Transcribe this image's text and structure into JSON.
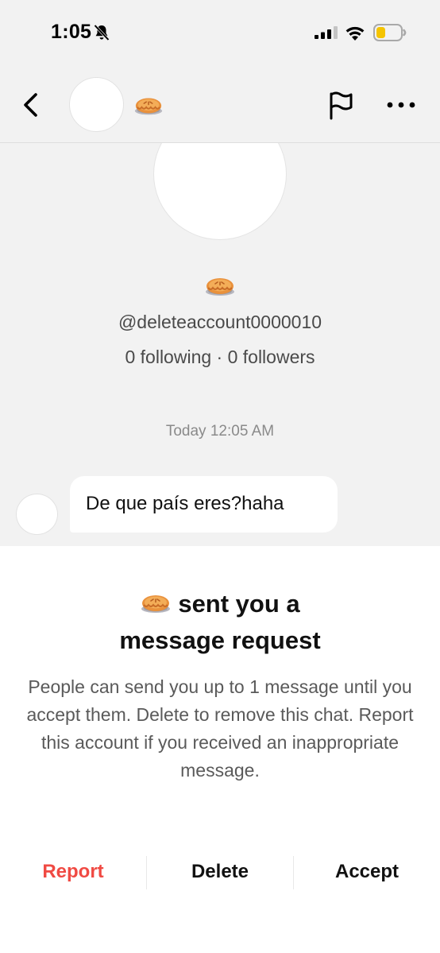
{
  "status_bar": {
    "time": "1:05",
    "icons": [
      "bell-slash-icon",
      "cellular-signal-icon",
      "wifi-icon",
      "battery-low-icon"
    ],
    "battery_color": "#f5c400"
  },
  "header": {
    "icons": [
      "chevron-left-icon",
      "pie-emoji-icon",
      "flag-icon",
      "more-horizontal-icon"
    ]
  },
  "profile": {
    "username": "@deleteaccount0000010",
    "stats": "0 following · 0 followers"
  },
  "chat": {
    "timestamp": "Today 12:05 AM",
    "messages": [
      {
        "text": "De que país eres?haha"
      }
    ]
  },
  "request": {
    "title_line1": "sent you a",
    "title_line2": "message request",
    "body": "People can send you up to 1 message until you accept them. Delete to remove this chat. Report this account if you received an inappropriate message.",
    "actions": {
      "report": "Report",
      "delete": "Delete",
      "accept": "Accept"
    },
    "report_color": "#f04a43"
  }
}
